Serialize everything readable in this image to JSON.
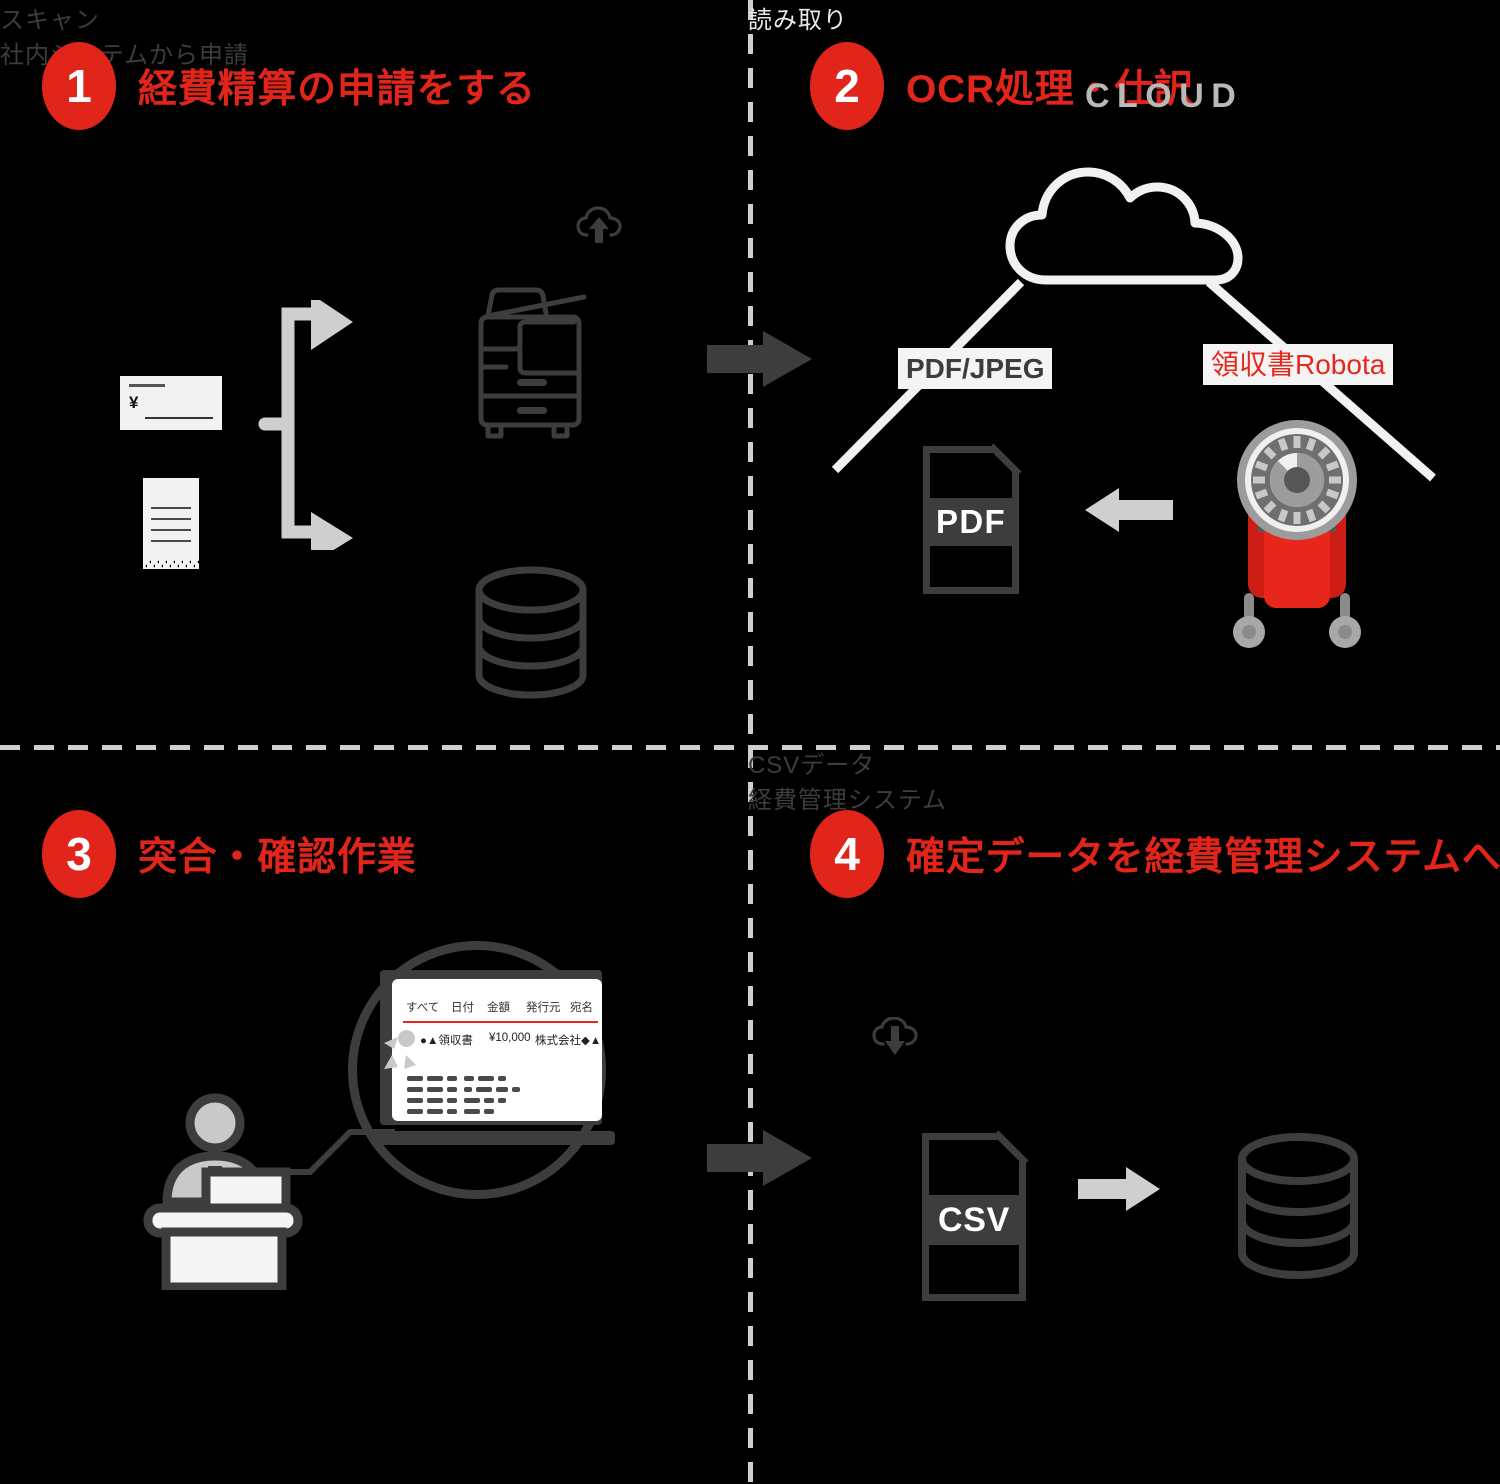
{
  "panels": [
    {
      "number": "1",
      "title": "経費精算の申請をする",
      "labels": {
        "scan": "スキャン",
        "internal_system": "社内システムから申請"
      },
      "invoice_currency": "¥",
      "icons": [
        "invoice-icon",
        "receipt-icon",
        "branch-arrow-icon",
        "cloud-upload-icon",
        "multifunction-printer-icon",
        "database-icon"
      ]
    },
    {
      "number": "2",
      "title": "OCR処理・仕訳",
      "labels": {
        "cloud": "CLOUD",
        "pdf_jpeg": "PDF/JPEG",
        "robota": "領収書Robota",
        "pdf_file": "PDF",
        "read": "読み取り"
      },
      "icons": [
        "cloud-outline-icon",
        "pdf-file-icon",
        "left-arrow-icon",
        "robot-scanner-icon"
      ]
    },
    {
      "number": "3",
      "title": "突合・確認作業",
      "screen": {
        "columns": [
          "すべて",
          "日付",
          "金額",
          "発行元",
          "宛名"
        ],
        "row": {
          "title": "●▲領収書",
          "amount": "¥10,000",
          "issuer": "株式会社◆▲"
        }
      },
      "icons": [
        "magnifier-circle-icon",
        "laptop-icon",
        "person-at-desk-icon",
        "click-indicator-icon"
      ]
    },
    {
      "number": "4",
      "title": "確定データを経費管理システムへ入力",
      "labels": {
        "csv_data": "CSVデータ",
        "expense_system": "経費管理システム",
        "csv_file": "CSV"
      },
      "icons": [
        "cloud-download-icon",
        "csv-file-icon",
        "right-arrow-icon",
        "database-icon"
      ]
    }
  ],
  "colors": {
    "background": "#000000",
    "accent_red": "#e1251b",
    "dark_gray": "#3d3d3d",
    "light_gray": "#cfcfcf",
    "off_white": "#f2f2f2"
  }
}
